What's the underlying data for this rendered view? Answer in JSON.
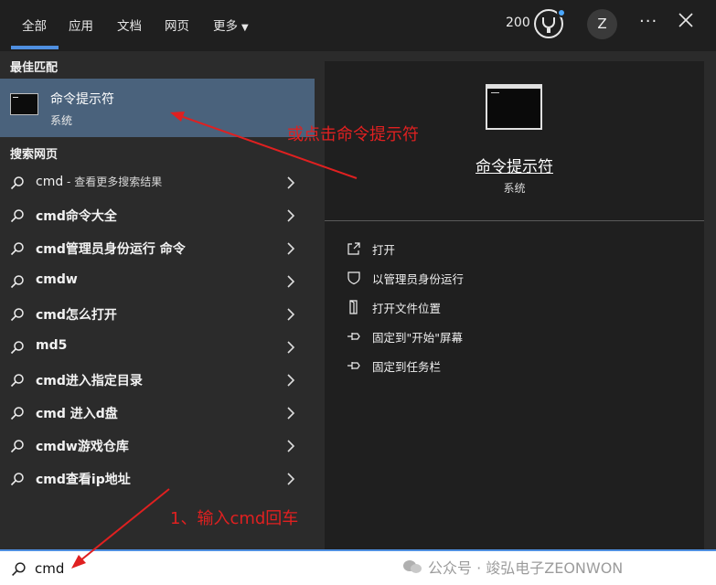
{
  "tabs": [
    {
      "label": "全部",
      "active": true
    },
    {
      "label": "应用"
    },
    {
      "label": "文档"
    },
    {
      "label": "网页"
    },
    {
      "label": "更多"
    }
  ],
  "header": {
    "points": "200",
    "avatar_initial": "Z",
    "more_glyph": "···"
  },
  "best_match": {
    "section_title": "最佳匹配",
    "name": "命令提示符",
    "type": "系统"
  },
  "web": {
    "section_title": "搜索网页",
    "items": [
      {
        "text": "cmd",
        "hint": " - 查看更多搜索结果"
      },
      {
        "text": "cmd命令大全"
      },
      {
        "text": "cmd管理员身份运行 命令"
      },
      {
        "text": "cmdw"
      },
      {
        "text": "cmd怎么打开"
      },
      {
        "text": "md5"
      },
      {
        "text": "cmd进入指定目录"
      },
      {
        "text": "cmd 进入d盘"
      },
      {
        "text": "cmdw游戏仓库"
      },
      {
        "text": "cmd查看ip地址"
      }
    ]
  },
  "preview": {
    "title": "命令提示符",
    "subtitle": "系统",
    "actions": [
      {
        "label": "打开",
        "icon": "open-icon"
      },
      {
        "label": "以管理员身份运行",
        "icon": "shield-icon"
      },
      {
        "label": "打开文件位置",
        "icon": "file-location-icon"
      },
      {
        "label": "固定到\"开始\"屏幕",
        "icon": "pin-icon"
      },
      {
        "label": "固定到任务栏",
        "icon": "pin-icon"
      }
    ]
  },
  "search": {
    "value": "cmd"
  },
  "watermark": "公众号 · 竣弘电子ZEONWON",
  "annotations": {
    "step1": "1、输入cmd回车",
    "step2": "或点击命令提示符"
  },
  "colors": {
    "accent": "#4f8fe0",
    "selected_bg": "#4a627c",
    "annotation": "#e02020"
  }
}
